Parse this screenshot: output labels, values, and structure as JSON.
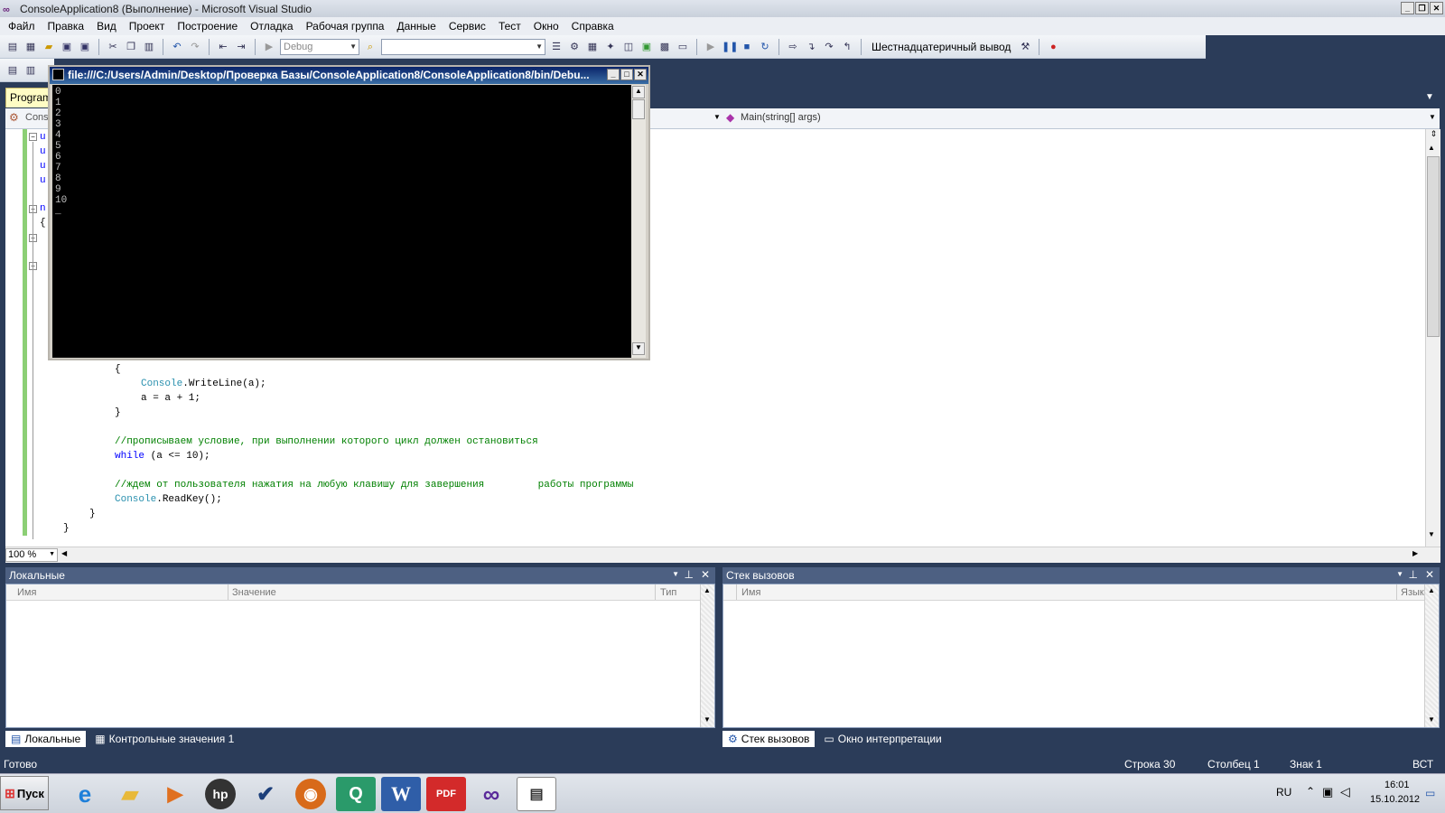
{
  "window": {
    "title": "ConsoleApplication8 (Выполнение) - Microsoft Visual Studio"
  },
  "menu": [
    "Файл",
    "Правка",
    "Вид",
    "Проект",
    "Построение",
    "Отладка",
    "Рабочая группа",
    "Данные",
    "Сервис",
    "Тест",
    "Окно",
    "Справка"
  ],
  "toolbar": {
    "config_combo": "Debug",
    "platform_combo": "",
    "hex_label": "Шестнадцатеричный вывод"
  },
  "editor": {
    "tab_label": "Program.cs",
    "nav_left": "Cons",
    "nav_right": "Main(string[] args)",
    "zoom": "100 %",
    "gutter_letters": [
      "u",
      "u",
      "u",
      "u",
      "n",
      "{"
    ],
    "code_lines": [
      {
        "text": "{",
        "kind": "plain"
      },
      {
        "pre": "",
        "cls": "Console",
        "post": ".WriteLine(a);"
      },
      {
        "text": "a = a + 1;",
        "kind": "plain"
      },
      {
        "text": "}",
        "kind": "plain"
      },
      {
        "text": "//прописываем условие, при выполнении которого цикл должен остановиться",
        "kind": "comment"
      },
      {
        "kw": "while",
        "post": " (a <= 10);"
      },
      {
        "text": "//ждем от пользователя нажатия на любую клавишу для завершения         работы программы",
        "kind": "comment"
      },
      {
        "cls": "Console",
        "post": ".ReadKey();"
      },
      {
        "text": "}",
        "kind": "plain"
      },
      {
        "text": "}",
        "kind": "plain"
      }
    ]
  },
  "console": {
    "title": "file:///C:/Users/Admin/Desktop/Проверка Базы/ConsoleApplication8/ConsoleApplication8/bin/Debu...",
    "output": "0\n1\n2\n3\n4\n5\n6\n7\n8\n9\n10\n_"
  },
  "locals_panel": {
    "title": "Локальные",
    "col_name": "Имя",
    "col_value": "Значение",
    "col_type": "Тип"
  },
  "callstack_panel": {
    "title": "Стек вызовов",
    "col_name": "Имя",
    "col_lang": "Язык"
  },
  "bottom_tabs_left": [
    "Локальные",
    "Контрольные значения 1"
  ],
  "bottom_tabs_right": [
    "Стек вызовов",
    "Окно интерпретации"
  ],
  "status": {
    "ready": "Готово",
    "row": "Строка 30",
    "col": "Столбец 1",
    "char": "Знак 1",
    "ins": "ВСТ"
  },
  "taskbar": {
    "start": "Пуск",
    "lang": "RU",
    "time": "16:01",
    "date": "15.10.2012"
  }
}
